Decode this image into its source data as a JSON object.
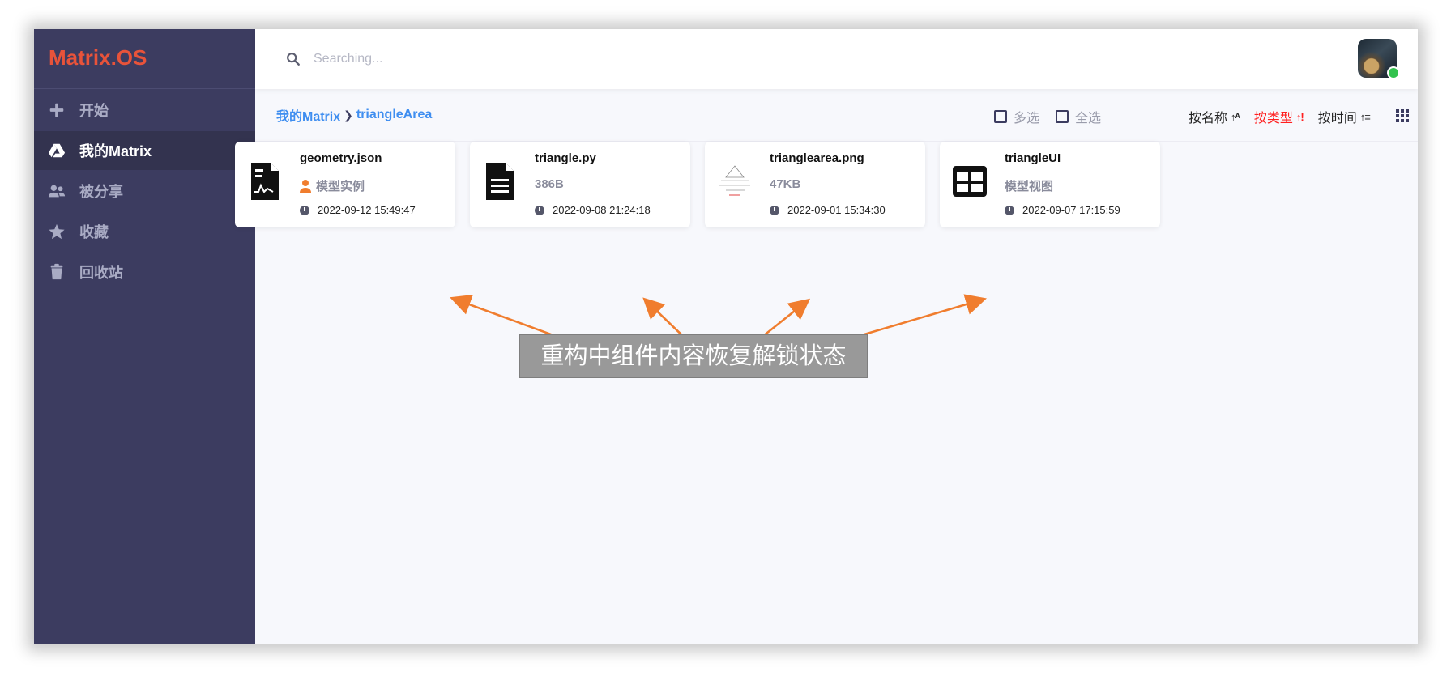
{
  "app": {
    "logo_text": "Matrix.OS",
    "colors": {
      "sidebar_bg": "#3c3c60",
      "logo": "#e8533a",
      "link": "#3f8ef0",
      "active_sort": "#ff1f1f",
      "annotation_arrow": "#f07d2e"
    }
  },
  "sidebar": {
    "items": [
      {
        "label": "开始",
        "icon": "plus-icon",
        "active": false
      },
      {
        "label": "我的Matrix",
        "icon": "drive-icon",
        "active": true
      },
      {
        "label": "被分享",
        "icon": "users-icon",
        "active": false
      },
      {
        "label": "收藏",
        "icon": "star-icon",
        "active": false
      },
      {
        "label": "回收站",
        "icon": "trash-icon",
        "active": false
      }
    ]
  },
  "header": {
    "search": {
      "placeholder": "Searching...",
      "value": ""
    },
    "avatar_status": "online"
  },
  "breadcrumb": {
    "root": "我的Matrix",
    "separator_icon": "chevron-right-icon",
    "current": "triangleArea"
  },
  "toolbar": {
    "checks": [
      {
        "label": "多选",
        "checked": false
      },
      {
        "label": "全选",
        "checked": false
      }
    ],
    "sorts": [
      {
        "label": "按名称",
        "icon": "sort-alpha-icon",
        "active": false
      },
      {
        "label": "按类型",
        "icon": "sort-type-icon",
        "active": true
      },
      {
        "label": "按时间",
        "icon": "sort-time-icon",
        "active": false
      }
    ],
    "view_icon": "grid-view-icon"
  },
  "files": [
    {
      "name": "geometry.json",
      "meta": "模型实例",
      "meta_icon": "user-icon",
      "date": "2022-09-12 15:49:47",
      "icon": "json-file-icon"
    },
    {
      "name": "triangle.py",
      "meta": "386B",
      "date": "2022-09-08 21:24:18",
      "icon": "document-icon"
    },
    {
      "name": "trianglearea.png",
      "meta": "47KB",
      "date": "2022-09-01 15:34:30",
      "icon": "image-thumbnail"
    },
    {
      "name": "triangleUI",
      "meta": "模型视图",
      "date": "2022-09-07 17:15:59",
      "icon": "table-view-icon"
    }
  ],
  "annotation": {
    "text": "重构中组件内容恢复解锁状态"
  }
}
